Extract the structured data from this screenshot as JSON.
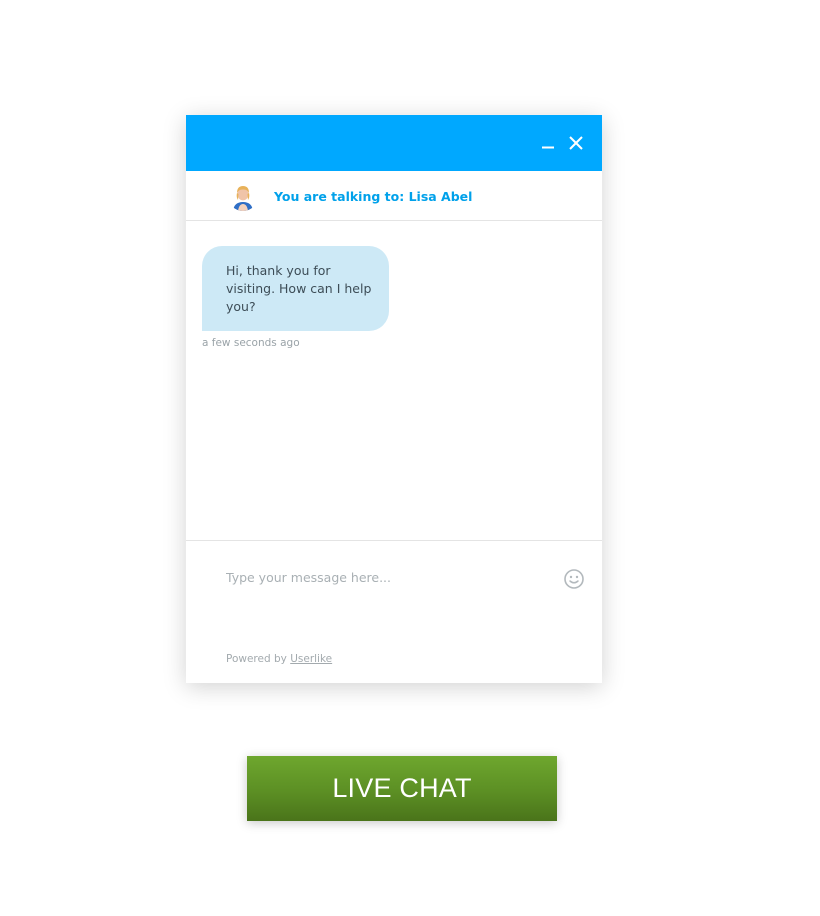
{
  "header": {
    "minimize_icon": "minimize-icon",
    "close_icon": "close-icon",
    "color": "#00a8ff"
  },
  "agent": {
    "label": "You are talking to: Lisa Abel",
    "avatar_icon": "agent-avatar"
  },
  "messages": [
    {
      "text": "Hi, thank you for visiting. How can I help you?",
      "time": "a few seconds ago"
    }
  ],
  "composer": {
    "placeholder": "Type your message here...",
    "emoji_icon": "smiley-icon",
    "powered_prefix": "Powered by",
    "powered_link": "Userlike"
  },
  "live_chat_button": {
    "label": "LIVE CHAT",
    "color": "#5c8f24"
  }
}
